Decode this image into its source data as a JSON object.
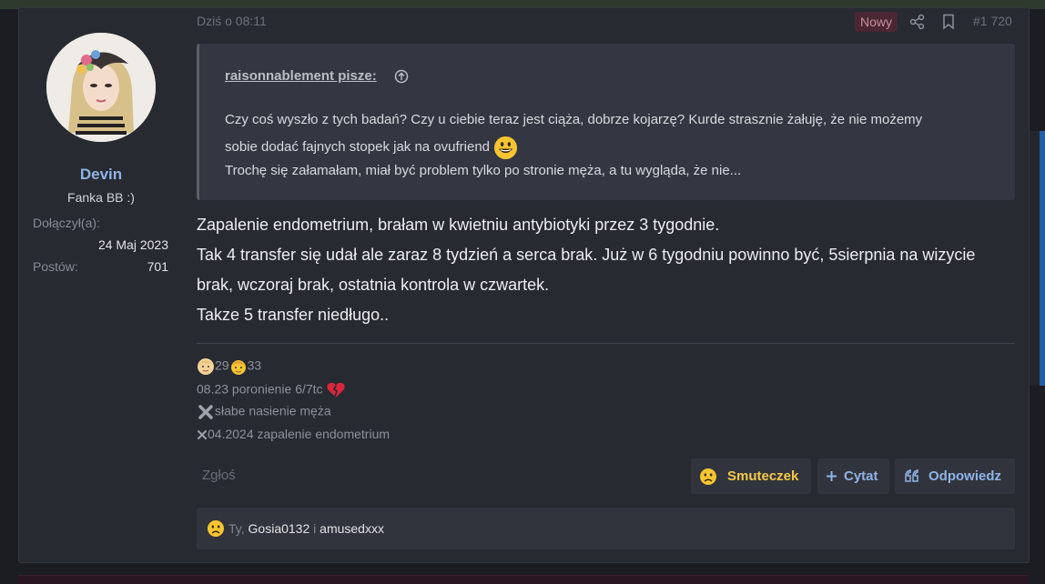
{
  "post": {
    "date": "Dziś o 08:11",
    "badge_new": "Nowy",
    "number": "#1 720",
    "user": {
      "name": "Devin",
      "title": "Fanka BB :)",
      "joined_label": "Dołączył(a):",
      "joined_value": "24 Maj 2023",
      "posts_label": "Postów:",
      "posts_value": "701"
    },
    "quote": {
      "author": "raisonnablement pisze:",
      "line1": "Czy coś wyszło z tych badań? Czy u ciebie teraz jest ciąża, dobrze kojarzę? Kurde strasznie żałuję, że nie możemy",
      "line2": "sobie dodać fajnych stopek jak na ovufriend",
      "line3": "Trochę się załamałam, miał być problem tylko po stronie męża, a tu wygląda, że nie..."
    },
    "body": [
      "Zapalenie endometrium, brałam w kwietniu antybiotyki przez 3 tygodnie.",
      "Tak 4 transfer się udał ale zaraz 8 tydzień a serca brak. Już w 6 tygodniu powinno być, 5sierpnia na wizycie",
      "brak, wczoraj brak, ostatnia kontrola w czwartek.",
      "Takze 5 transfer niedługo.."
    ],
    "signature": {
      "age_her": "29",
      "age_him": "33",
      "line2": "08.23 poronienie 6/7tc",
      "line3": "słabe nasienie męża",
      "line4": "04.2024 zapalenie endometrium"
    },
    "actions": {
      "report": "Zgłoś",
      "react": "Smuteczek",
      "quote": "Cytat",
      "reply": "Odpowiedz"
    },
    "reactions": {
      "you": "Ty,",
      "user1": "Gosia0132",
      "and": "i",
      "user2": "amusedxxx"
    }
  },
  "colors": {
    "accent": "#8fb3e6",
    "reaction": "#f3c94a",
    "badge": "#4a2733"
  }
}
